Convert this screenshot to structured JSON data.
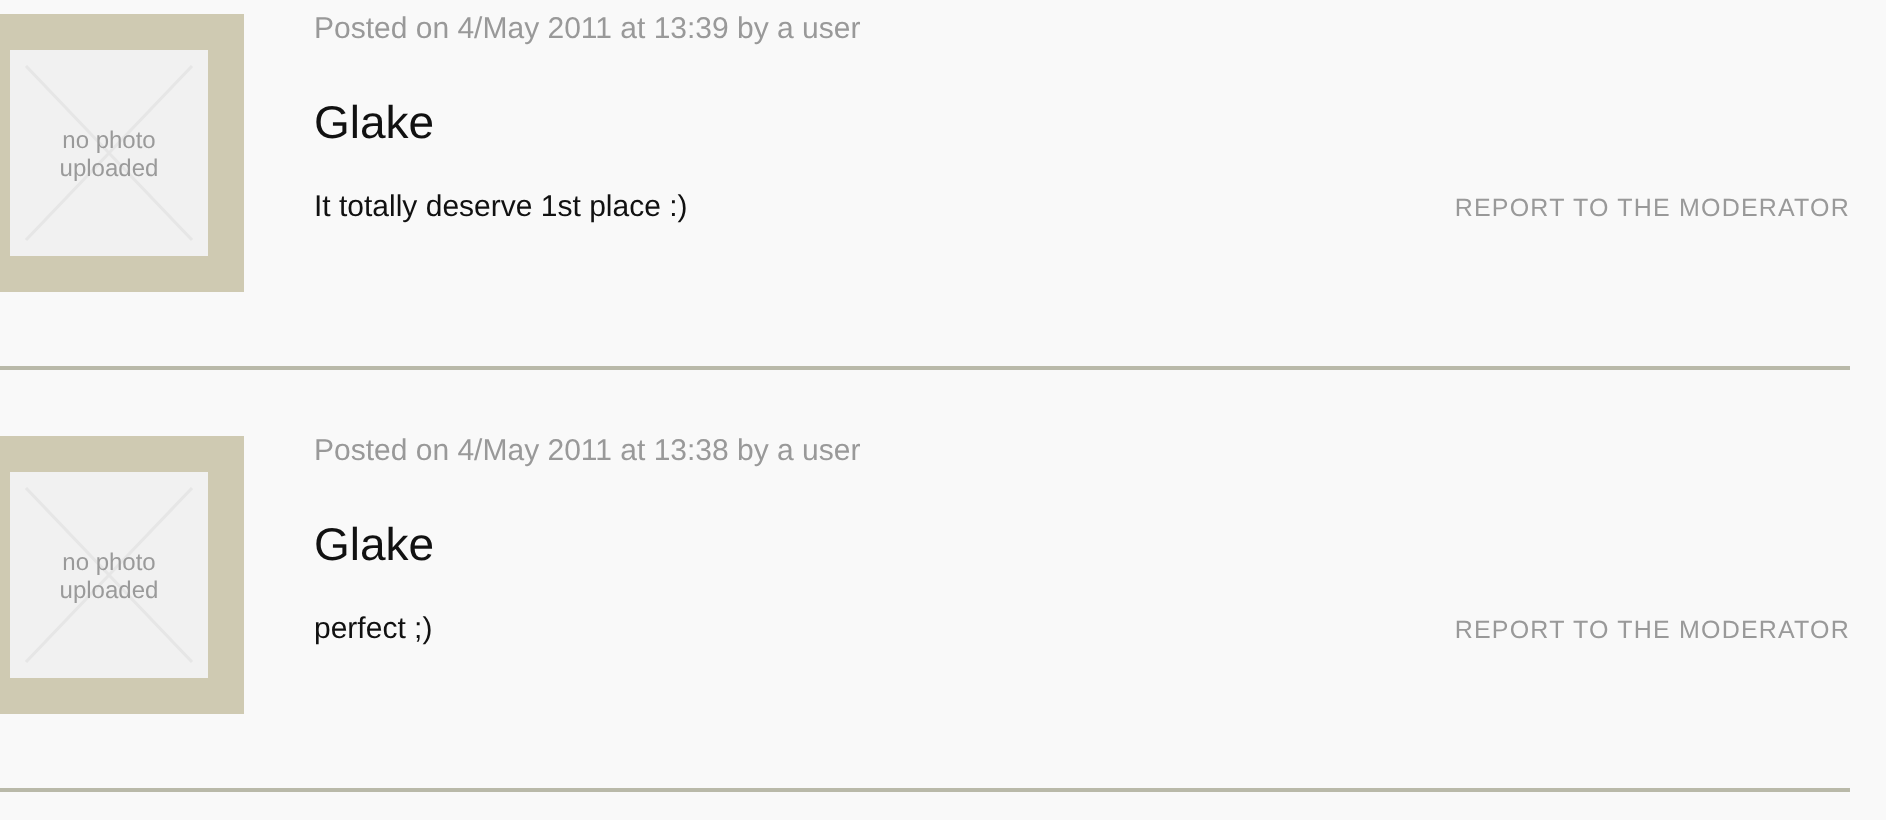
{
  "comments": [
    {
      "avatar": {
        "placeholder_text": "no photo uploaded"
      },
      "posted": "Posted on 4/May 2011 at 13:39 by a user",
      "author": "Glake",
      "text": "It totally deserve 1st place :)",
      "report_link": "REPORT TO THE MODERATOR"
    },
    {
      "avatar": {
        "placeholder_text": "no photo uploaded"
      },
      "posted": "Posted on 4/May 2011 at 13:38 by a user",
      "author": "Glake",
      "text": "perfect ;)",
      "report_link": "REPORT TO THE MODERATOR"
    }
  ]
}
